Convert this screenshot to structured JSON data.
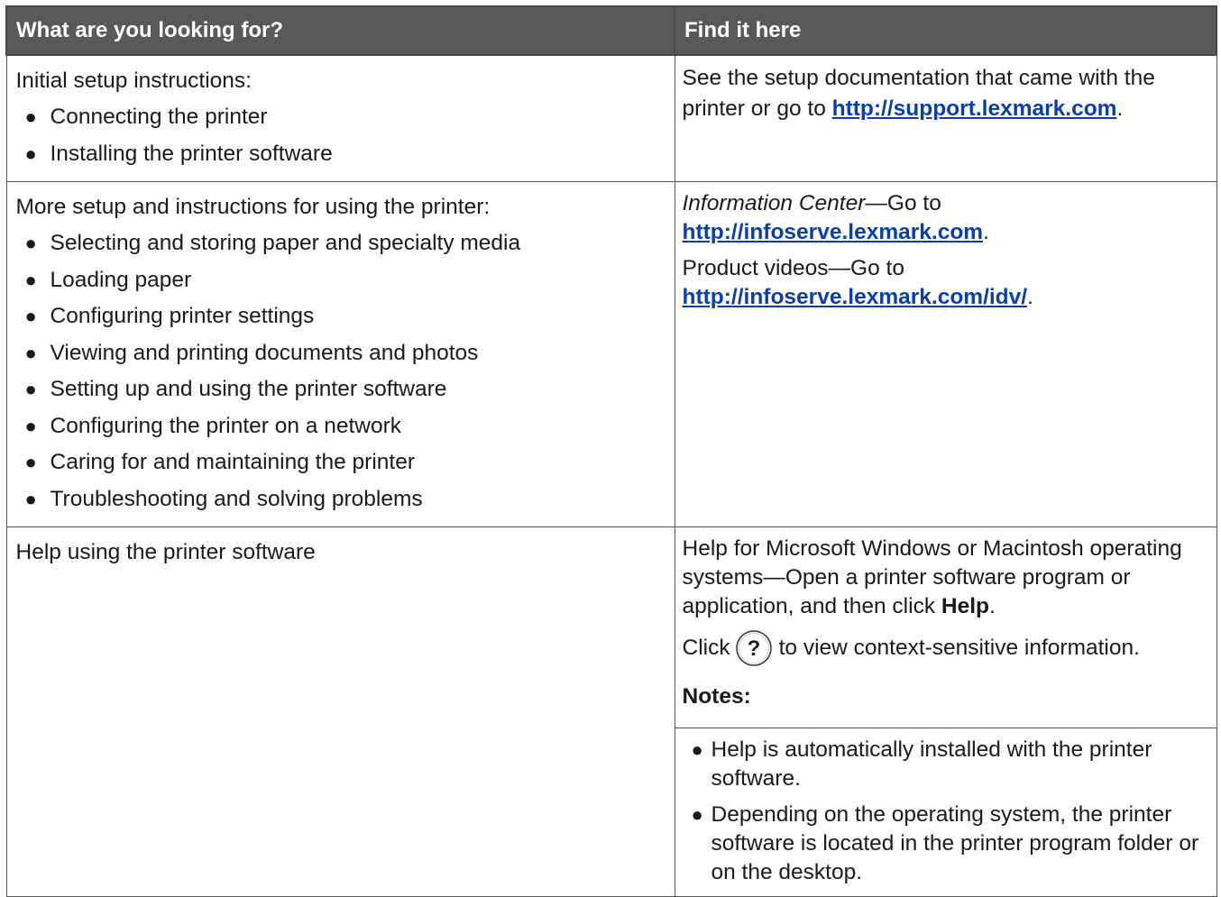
{
  "table": {
    "headers": [
      "What are you looking for?",
      "Find it here"
    ],
    "row1": {
      "left_intro": "Initial setup instructions:",
      "left_bullets": [
        "Connecting the printer",
        "Installing the printer software"
      ],
      "right_text_a": "See the setup documentation that came with the printer or go to ",
      "right_link": "http://support.lexmark.com",
      "right_text_b": "."
    },
    "row2": {
      "left_intro": "More setup and instructions for using the printer:",
      "left_bullets": [
        "Selecting and storing paper and specialty media",
        "Loading paper",
        "Configuring printer settings",
        "Viewing and printing documents and photos",
        "Setting up and using the printer software",
        "Configuring the printer on a network",
        "Caring for and maintaining the printer",
        "Troubleshooting and solving problems"
      ],
      "right_p1_italic": "Information Center",
      "right_p1_text": "—Go to",
      "right_p1_link": "http://infoserve.lexmark.com",
      "right_p1_end": ".",
      "right_p2_text": "Product videos—Go to",
      "right_p2_link": "http://infoserve.lexmark.com/idv/",
      "right_p2_end": "."
    },
    "row3": {
      "left_text": "Help using the printer software",
      "right_p1_text": "Help for Microsoft Windows or Macintosh operating systems—Open a printer software program or application, and then click ",
      "right_p1_bold": "Help",
      "right_p1_end": ".",
      "click_prefix": "Click",
      "click_suffix": "to view context-sensitive information.",
      "help_icon_glyph": "?",
      "notes_label": "Notes:",
      "notes": [
        "Help is automatically installed with the printer software.",
        "Depending on the operating system, the printer software is located in the printer program folder or on the desktop."
      ]
    }
  },
  "colors": {
    "header_bg": "#595959",
    "header_text": "#ffffff",
    "link": "#0b3fa8",
    "border": "#555555"
  }
}
